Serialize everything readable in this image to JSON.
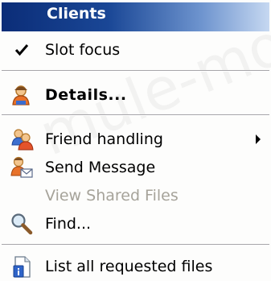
{
  "menu": {
    "header": "Clients",
    "items": [
      {
        "label": "Slot focus",
        "checked": true,
        "icon": "check-icon"
      },
      {
        "label": "Details...",
        "icon": "user-details-icon"
      },
      {
        "label": "Friend handling",
        "icon": "friends-icon",
        "submenu": true
      },
      {
        "label": "Send Message",
        "icon": "send-message-icon"
      },
      {
        "label": "View Shared Files",
        "disabled": true
      },
      {
        "label": "Find...",
        "icon": "magnifier-icon"
      },
      {
        "label": "List all requested files",
        "icon": "file-list-icon"
      }
    ]
  },
  "watermark": "mule-mod",
  "colors": {
    "header_dark": "#0b2d78",
    "header_light": "#c6d8f1",
    "disabled_text": "#a6a39a"
  }
}
